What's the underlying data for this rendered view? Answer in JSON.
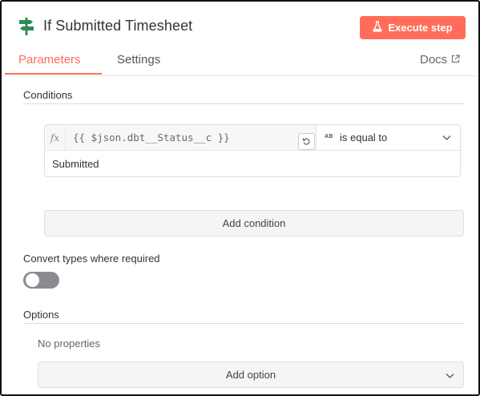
{
  "header": {
    "title": "If Submitted Timesheet",
    "title_icon": "signpost-icon",
    "execute_label": "Execute step",
    "execute_icon": "flask-icon"
  },
  "tabs": [
    {
      "label": "Parameters",
      "active": true
    },
    {
      "label": "Settings",
      "active": false
    }
  ],
  "docs": {
    "label": "Docs",
    "icon": "external-link-icon"
  },
  "conditions": {
    "section_label": "Conditions",
    "fx_label": "fx",
    "left_value": "{{ $json.dbt__Status__c }}",
    "type_badge": "AB",
    "operator": "is equal to",
    "right_value": "Submitted",
    "add_label": "Add condition"
  },
  "convert": {
    "label": "Convert types where required",
    "enabled": false
  },
  "options": {
    "section_label": "Options",
    "empty_text": "No properties",
    "add_label": "Add option"
  },
  "colors": {
    "accent": "#ff6d5a",
    "title_icon": "#2e8b57"
  }
}
